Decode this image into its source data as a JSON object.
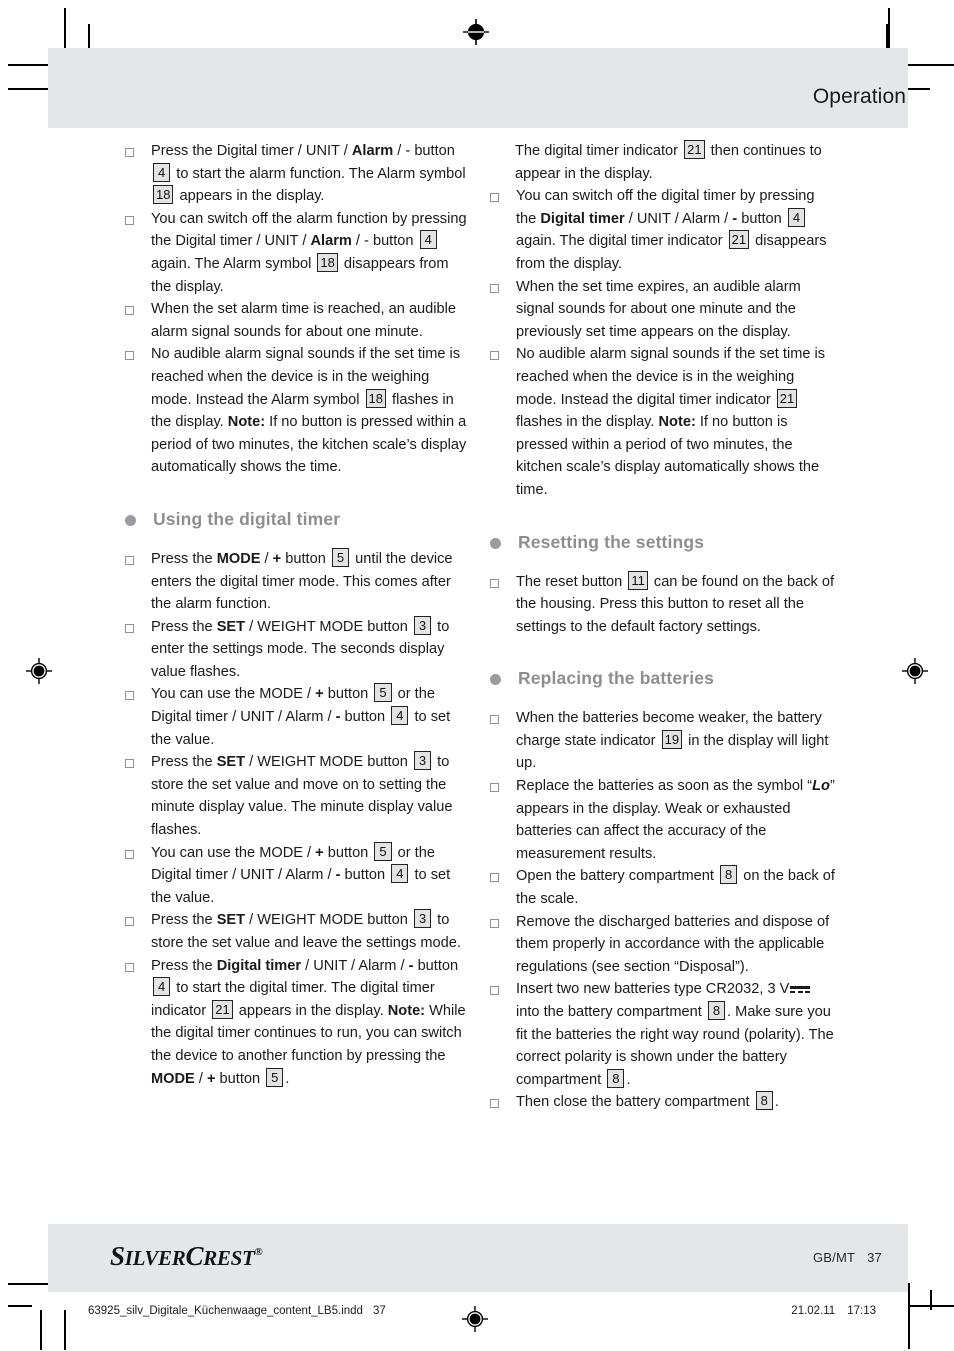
{
  "page": {
    "header_title": "Operation",
    "brand_part1": "S",
    "brand_part2": "ILVER",
    "brand_part3": "C",
    "brand_part4": "REST",
    "brand_sup": "®",
    "locale": "GB/MT",
    "page_number": "37",
    "print_filename": "63925_silv_Digitale_Küchenwaage_content_LB5.indd",
    "print_page": "37",
    "print_date": "21.02.11",
    "print_time": "17:13",
    "colors": {
      "band_gray": "#e5e6e8",
      "heading_gray": "#8d8e92",
      "refbox_fill": "#e3e3e3",
      "text": "#1a1a1a"
    }
  },
  "left_column": {
    "intro_bullets": [
      {
        "parts": [
          {
            "t": "Press the Digital timer / UNIT / ",
            "s": "n"
          },
          {
            "t": "Alarm",
            "s": "b"
          },
          {
            "t": " / - button ",
            "s": "n"
          },
          {
            "t": "4",
            "s": "ref"
          },
          {
            "t": " to start the alarm function. The Alarm symbol ",
            "s": "n"
          },
          {
            "t": "18",
            "s": "ref"
          },
          {
            "t": " appears in the display.",
            "s": "n"
          }
        ]
      },
      {
        "parts": [
          {
            "t": "You can switch off the alarm function by pressing the Digital timer / UNIT / ",
            "s": "n"
          },
          {
            "t": "Alarm",
            "s": "b"
          },
          {
            "t": " / - button ",
            "s": "n"
          },
          {
            "t": "4",
            "s": "ref"
          },
          {
            "t": " again. The Alarm symbol ",
            "s": "n"
          },
          {
            "t": "18",
            "s": "ref"
          },
          {
            "t": " disappears from the display.",
            "s": "n"
          }
        ]
      },
      {
        "parts": [
          {
            "t": "When the set alarm time is reached, an audible alarm signal sounds for about one minute.",
            "s": "n"
          }
        ]
      },
      {
        "parts": [
          {
            "t": "No audible alarm signal sounds if the set time is reached when the device is in the weighing mode. Instead the Alarm symbol ",
            "s": "n"
          },
          {
            "t": "18",
            "s": "ref"
          },
          {
            "t": " flashes in the display. ",
            "s": "n"
          },
          {
            "t": "Note:",
            "s": "b"
          },
          {
            "t": " If no button is pressed within a period of two minutes, the kitchen scale’s display automatically shows the time.",
            "s": "n"
          }
        ]
      }
    ],
    "section_heading": "Using the digital timer",
    "timer_bullets": [
      {
        "parts": [
          {
            "t": "Press the ",
            "s": "n"
          },
          {
            "t": "MODE",
            "s": "b"
          },
          {
            "t": " / ",
            "s": "n"
          },
          {
            "t": "+",
            "s": "b"
          },
          {
            "t": " button ",
            "s": "n"
          },
          {
            "t": "5",
            "s": "ref"
          },
          {
            "t": " until the device enters the digital timer mode. This comes after the alarm function.",
            "s": "n"
          }
        ]
      },
      {
        "parts": [
          {
            "t": "Press the ",
            "s": "n"
          },
          {
            "t": "SET",
            "s": "b"
          },
          {
            "t": " / WEIGHT MODE button ",
            "s": "n"
          },
          {
            "t": "3",
            "s": "ref"
          },
          {
            "t": " to enter the settings mode. The seconds display value flashes.",
            "s": "n"
          }
        ]
      },
      {
        "parts": [
          {
            "t": "You can use the MODE / ",
            "s": "n"
          },
          {
            "t": "+",
            "s": "b"
          },
          {
            "t": " button ",
            "s": "n"
          },
          {
            "t": "5",
            "s": "ref"
          },
          {
            "t": " or the Digital timer / UNIT / Alarm / ",
            "s": "n"
          },
          {
            "t": "-",
            "s": "b"
          },
          {
            "t": " button ",
            "s": "n"
          },
          {
            "t": "4",
            "s": "ref"
          },
          {
            "t": " to set the value.",
            "s": "n"
          }
        ]
      },
      {
        "parts": [
          {
            "t": "Press the ",
            "s": "n"
          },
          {
            "t": "SET",
            "s": "b"
          },
          {
            "t": " / WEIGHT MODE button ",
            "s": "n"
          },
          {
            "t": "3",
            "s": "ref"
          },
          {
            "t": " to store the set value and move on to setting the minute display value. The minute display value flashes.",
            "s": "n"
          }
        ]
      },
      {
        "parts": [
          {
            "t": "You can use the MODE / ",
            "s": "n"
          },
          {
            "t": "+",
            "s": "b"
          },
          {
            "t": " button ",
            "s": "n"
          },
          {
            "t": "5",
            "s": "ref"
          },
          {
            "t": " or the Digital timer / UNIT / Alarm / ",
            "s": "n"
          },
          {
            "t": "-",
            "s": "b"
          },
          {
            "t": " button ",
            "s": "n"
          },
          {
            "t": "4",
            "s": "ref"
          },
          {
            "t": " to set the value.",
            "s": "n"
          }
        ]
      },
      {
        "parts": [
          {
            "t": "Press the ",
            "s": "n"
          },
          {
            "t": "SET",
            "s": "b"
          },
          {
            "t": " / WEIGHT MODE button ",
            "s": "n"
          },
          {
            "t": "3",
            "s": "ref"
          },
          {
            "t": " to store the set value and leave the settings mode.",
            "s": "n"
          }
        ]
      },
      {
        "parts": [
          {
            "t": "Press the ",
            "s": "n"
          },
          {
            "t": "Digital timer",
            "s": "b"
          },
          {
            "t": " / UNIT / Alarm / ",
            "s": "n"
          },
          {
            "t": "-",
            "s": "b"
          },
          {
            "t": " button ",
            "s": "n"
          },
          {
            "t": "4",
            "s": "ref"
          },
          {
            "t": " to start the digital timer. The digital timer indicator ",
            "s": "n"
          },
          {
            "t": "21",
            "s": "ref"
          },
          {
            "t": " appears in the display. ",
            "s": "n"
          },
          {
            "t": "Note:",
            "s": "b"
          },
          {
            "t": " While the digital timer continues to run, you can switch the device to another function by pressing the ",
            "s": "n"
          },
          {
            "t": "MODE",
            "s": "b"
          },
          {
            "t": " / ",
            "s": "n"
          },
          {
            "t": "+",
            "s": "b"
          },
          {
            "t": " button ",
            "s": "n"
          },
          {
            "t": "5",
            "s": "ref"
          },
          {
            "t": ".",
            "s": "n"
          }
        ]
      }
    ]
  },
  "right_column": {
    "continuation": {
      "parts": [
        {
          "t": "The digital timer indicator ",
          "s": "n"
        },
        {
          "t": "21",
          "s": "ref"
        },
        {
          "t": " then continues to appear in the display.",
          "s": "n"
        }
      ]
    },
    "timer_bullets": [
      {
        "parts": [
          {
            "t": "You can switch off the digital timer by pressing the ",
            "s": "n"
          },
          {
            "t": "Digital timer",
            "s": "b"
          },
          {
            "t": " / UNIT / Alarm / ",
            "s": "n"
          },
          {
            "t": "-",
            "s": "b"
          },
          {
            "t": " button ",
            "s": "n"
          },
          {
            "t": "4",
            "s": "ref"
          },
          {
            "t": " again. The digital timer indicator ",
            "s": "n"
          },
          {
            "t": "21",
            "s": "ref"
          },
          {
            "t": " disappears from the display.",
            "s": "n"
          }
        ]
      },
      {
        "parts": [
          {
            "t": "When the set time expires, an audible alarm signal sounds for about one minute and the previously set time appears on the display.",
            "s": "n"
          }
        ]
      },
      {
        "parts": [
          {
            "t": "No audible alarm signal sounds if the set time is reached when the device is in the weighing mode. Instead the digital timer indicator ",
            "s": "n"
          },
          {
            "t": "21",
            "s": "ref"
          },
          {
            "t": " flashes in the display. ",
            "s": "n"
          },
          {
            "t": "Note:",
            "s": "b"
          },
          {
            "t": " If no button is pressed within a period of two minutes, the kitchen scale’s display automatically shows the time.",
            "s": "n"
          }
        ]
      }
    ],
    "reset_heading": "Resetting the settings",
    "reset_bullets": [
      {
        "parts": [
          {
            "t": "The reset button ",
            "s": "n"
          },
          {
            "t": "11",
            "s": "ref"
          },
          {
            "t": " can be found on the back of the housing. Press this button to reset all the settings to the default factory settings.",
            "s": "n"
          }
        ]
      }
    ],
    "battery_heading": "Replacing the batteries",
    "battery_bullets": [
      {
        "parts": [
          {
            "t": "When the batteries become weaker, the battery charge state indicator ",
            "s": "n"
          },
          {
            "t": "19",
            "s": "ref"
          },
          {
            "t": " in the display will light up.",
            "s": "n"
          }
        ]
      },
      {
        "parts": [
          {
            "t": "Replace the batteries as soon as the symbol “",
            "s": "n"
          },
          {
            "t": "Lo",
            "s": "lo"
          },
          {
            "t": "” appears in the display. Weak or exhausted batteries can affect the accuracy of the measurement results.",
            "s": "n"
          }
        ]
      },
      {
        "parts": [
          {
            "t": "Open the battery compartment ",
            "s": "n"
          },
          {
            "t": "8",
            "s": "ref"
          },
          {
            "t": " on the back of the scale.",
            "s": "n"
          }
        ]
      },
      {
        "parts": [
          {
            "t": "Remove the discharged batteries and dispose of them properly in accordance with the applicable regulations (see section “Disposal”).",
            "s": "n"
          }
        ]
      },
      {
        "parts": [
          {
            "t": "Insert two new batteries type CR2032, 3 V",
            "s": "n"
          },
          {
            "t": "",
            "s": "dc"
          },
          {
            "t": " into the battery compartment ",
            "s": "n"
          },
          {
            "t": "8",
            "s": "ref"
          },
          {
            "t": ". Make sure you fit the batteries the right way round (polarity). The correct polarity is shown under the battery compartment ",
            "s": "n"
          },
          {
            "t": "8",
            "s": "ref"
          },
          {
            "t": ".",
            "s": "n"
          }
        ]
      },
      {
        "parts": [
          {
            "t": "Then close the battery compartment ",
            "s": "n"
          },
          {
            "t": "8",
            "s": "ref"
          },
          {
            "t": ".",
            "s": "n"
          }
        ]
      }
    ]
  }
}
